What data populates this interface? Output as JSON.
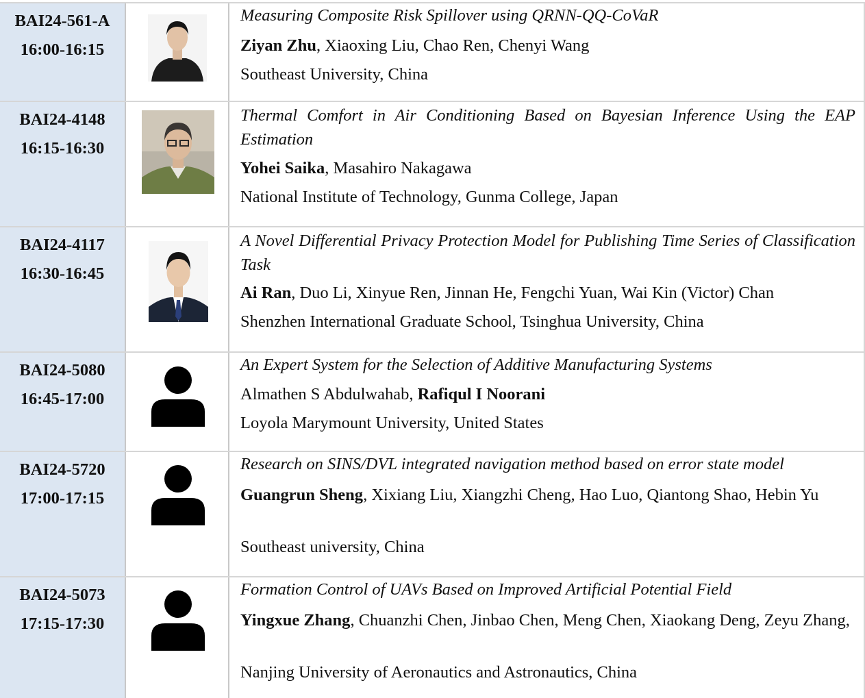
{
  "rows": [
    {
      "code": "BAI24-561-A",
      "time": "16:00-16:15",
      "title": "Measuring Composite Risk Spillover using QRNN-QQ-CoVaR",
      "presenter": "Ziyan Zhu",
      "presenter_suffix": ", Xiaoxing Liu, Chao Ren, Chenyi Wang",
      "affiliation": "Southeast University, China",
      "photo": "photo-presenter"
    },
    {
      "code": "BAI24-4148",
      "time": "16:15-16:30",
      "title": "Thermal Comfort in Air Conditioning Based on Bayesian Inference Using the EAP Estimation",
      "presenter": "Yohei Saika",
      "presenter_suffix": ", Masahiro Nakagawa",
      "affiliation": "National Institute of Technology, Gunma College, Japan",
      "photo": "photo-presenter"
    },
    {
      "code": "BAI24-4117",
      "time": "16:30-16:45",
      "title": "A Novel Differential Privacy Protection Model for Publishing Time Series of Classification Task",
      "presenter": "Ai Ran",
      "presenter_suffix": ", Duo Li, Xinyue Ren, Jinnan He, Fengchi Yuan, Wai Kin (Victor) Chan",
      "affiliation": "Shenzhen International Graduate School, Tsinghua University, China",
      "photo": "photo-presenter"
    },
    {
      "code": "BAI24-5080",
      "time": "16:45-17:00",
      "title": "An Expert System for the Selection of Additive Manufacturing Systems",
      "author_prefix": "Almathen S Abdulwahab, ",
      "presenter": "Rafiqul I Noorani",
      "affiliation": "Loyola Marymount University, United States",
      "photo": "person-icon"
    },
    {
      "code": "BAI24-5720",
      "time": "17:00-17:15",
      "title": "Research on SINS/DVL integrated navigation method based on error state model",
      "presenter": "Guangrun Sheng",
      "presenter_suffix": ", Xixiang Liu, Xiangzhi Cheng, Hao Luo, Qiantong Shao, Hebin Yu",
      "affiliation": "Southeast university, China",
      "photo": "person-icon"
    },
    {
      "code": "BAI24-5073",
      "time": "17:15-17:30",
      "title": "Formation Control of UAVs Based on Improved Artificial Potential Field",
      "presenter": "Yingxue Zhang",
      "presenter_suffix": ", Chuanzhi Chen, Jinbao Chen, Meng Chen, Xiaokang Deng, Zeyu Zhang,",
      "affiliation": "Nanjing University of Aeronautics and Astronautics, China",
      "photo": "person-icon"
    }
  ],
  "colors": {
    "id_cell_bg": "#dce6f2",
    "border": "#d6d6d6"
  }
}
